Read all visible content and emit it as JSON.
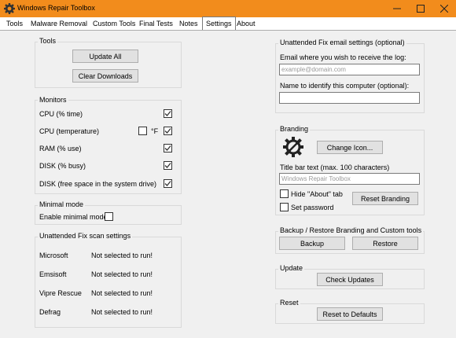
{
  "window": {
    "title": "Windows Repair Toolbox"
  },
  "tabs": [
    "Tools",
    "Malware Removal",
    "Custom Tools",
    "Final Tests",
    "Notes",
    "Settings",
    "About"
  ],
  "active_tab": "Settings",
  "tools_group": {
    "title": "Tools",
    "update_all": "Update All",
    "clear_downloads": "Clear Downloads"
  },
  "monitors": {
    "title": "Monitors",
    "items": [
      {
        "label": "CPU (% time)",
        "checked": true
      },
      {
        "label": "CPU (temperature)",
        "checked": true,
        "fahrenheit_label": "°F",
        "fahrenheit_checked": false
      },
      {
        "label": "RAM (% use)",
        "checked": true
      },
      {
        "label": "DISK (% busy)",
        "checked": true
      },
      {
        "label": "DISK (free space in the system drive)",
        "checked": true
      }
    ]
  },
  "minimal_mode": {
    "title": "Minimal mode",
    "enable_label": "Enable minimal mode",
    "checked": false
  },
  "scan_settings": {
    "title": "Unattended Fix scan settings",
    "rows": [
      {
        "name": "Microsoft",
        "status": "Not selected to run!"
      },
      {
        "name": "Emsisoft",
        "status": "Not selected to run!"
      },
      {
        "name": "Vipre Rescue",
        "status": "Not selected to run!"
      },
      {
        "name": "Defrag",
        "status": "Not selected to run!"
      }
    ]
  },
  "email": {
    "title": "Unattended Fix email settings (optional)",
    "email_label": "Email where you wish to receive the log:",
    "email_placeholder": "example@domain.com",
    "name_label": "Name to identify this computer (optional):",
    "name_value": ""
  },
  "branding": {
    "title": "Branding",
    "change_icon": "Change Icon...",
    "title_bar_label": "Title bar text (max. 100 characters)",
    "title_bar_placeholder": "Windows Repair Toolbox",
    "hide_about_label": "Hide \"About\" tab",
    "hide_about_checked": false,
    "set_password_label": "Set password",
    "set_password_checked": false,
    "reset_branding": "Reset Branding"
  },
  "backup": {
    "title": "Backup / Restore Branding and Custom tools",
    "backup": "Backup",
    "restore": "Restore"
  },
  "update": {
    "title": "Update",
    "check_updates": "Check Updates"
  },
  "reset": {
    "title": "Reset",
    "reset_defaults": "Reset to Defaults"
  },
  "colors": {
    "titlebar": "#f28c1c",
    "panel": "#f0f0f0",
    "button": "#e1e1e1",
    "border": "#d9d9d9"
  },
  "icons": {
    "app": "gear-wrench-icon",
    "branding": "gear-icon"
  }
}
